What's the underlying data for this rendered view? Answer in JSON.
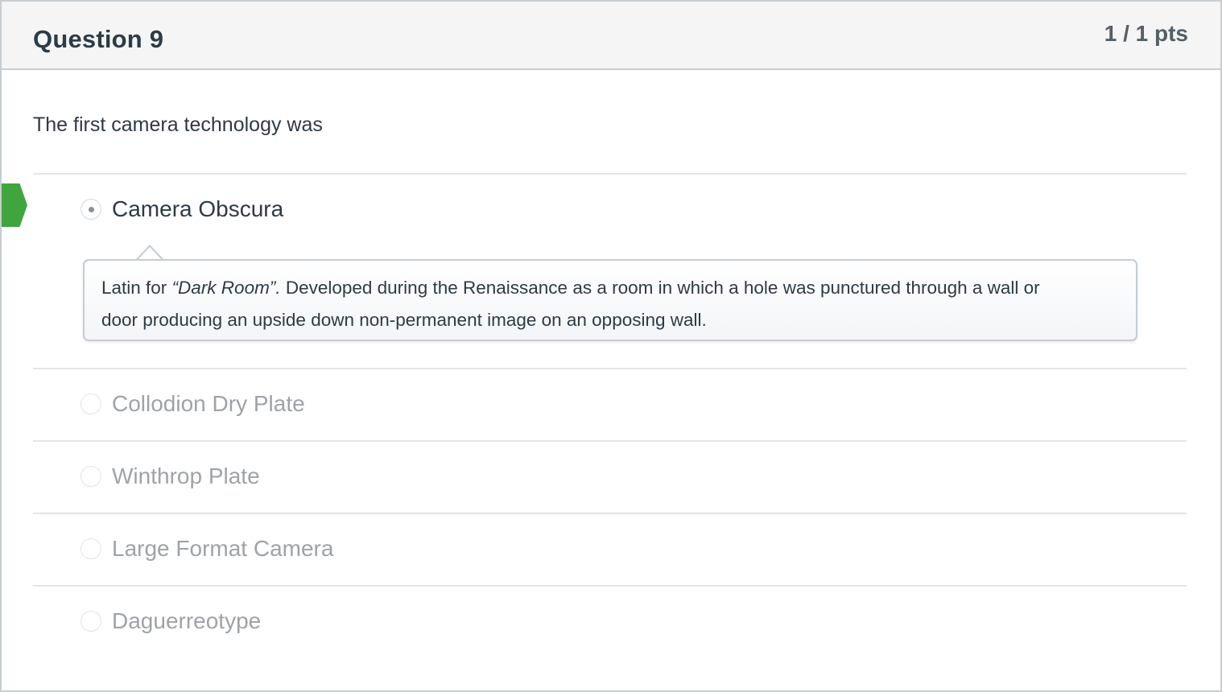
{
  "question": {
    "title": "Question 9",
    "points": "1 / 1 pts",
    "text": "The first camera technology was"
  },
  "answers": [
    {
      "label": "Camera Obscura",
      "selected": true,
      "correct": true
    },
    {
      "label": "Collodion Dry Plate",
      "selected": false
    },
    {
      "label": "Winthrop Plate",
      "selected": false
    },
    {
      "label": "Large Format Camera",
      "selected": false
    },
    {
      "label": "Daguerreotype",
      "selected": false
    }
  ],
  "comment": {
    "prefix": "Latin for ",
    "italic": "“Dark Room”.",
    "line1_rest": " Developed during the Renaissance as a room in which a hole was punctured through a wall or",
    "line2": "door producing an upside down non-permanent image on an opposing wall."
  },
  "colors": {
    "correct_marker": "#3fa63f",
    "header_bg": "#f5f5f5",
    "text": "#2d3b45",
    "muted_text": "#9ea3a7"
  },
  "icons": {
    "correct_marker": "correct-answer-arrow-icon"
  }
}
